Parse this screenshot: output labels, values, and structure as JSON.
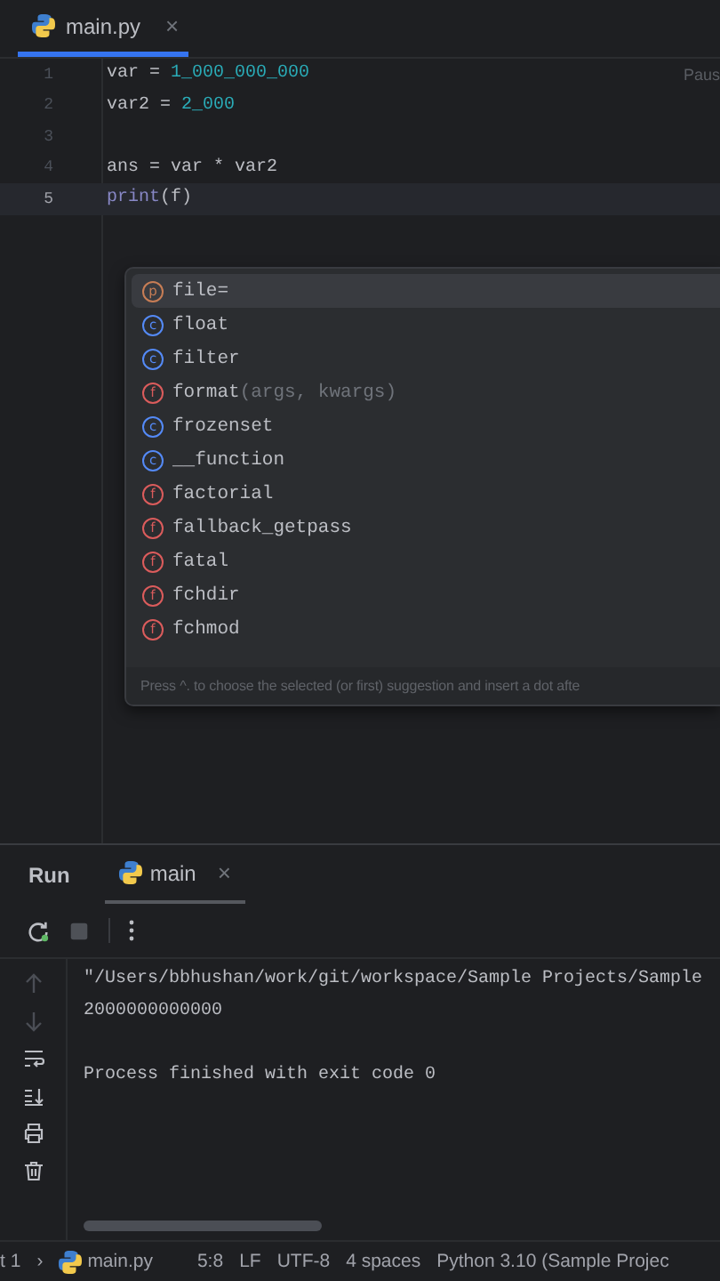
{
  "editor_tabs": [
    {
      "label": "main.py",
      "close": "×",
      "selected": true
    }
  ],
  "code_lines": [
    {
      "number": "1",
      "current": false,
      "tokens": [
        {
          "kind": "text",
          "text": "var = "
        },
        {
          "kind": "number",
          "text": "1_000_000_000"
        }
      ],
      "hint": "Paus"
    },
    {
      "number": "2",
      "current": false,
      "tokens": [
        {
          "kind": "text",
          "text": "var2 = "
        },
        {
          "kind": "number",
          "text": "2_000"
        }
      ]
    },
    {
      "number": "3",
      "current": false
    },
    {
      "number": "4",
      "current": false,
      "tokens": [
        {
          "kind": "text",
          "text": "ans = var * var2"
        }
      ]
    },
    {
      "number": "5",
      "current": true,
      "tokens": [
        {
          "kind": "builtin",
          "text": "print"
        },
        {
          "kind": "text",
          "text": "(f)"
        }
      ]
    }
  ],
  "completion": {
    "items": [
      {
        "kind": "parameter",
        "badge": "p",
        "name": "file=",
        "selected": true
      },
      {
        "kind": "class",
        "badge": "c",
        "name": "float",
        "selected": false
      },
      {
        "kind": "class",
        "badge": "c",
        "name": "filter",
        "selected": false
      },
      {
        "kind": "function",
        "badge": "f",
        "name": "format",
        "params": "(args, kwargs)",
        "selected": false
      },
      {
        "kind": "class",
        "badge": "c",
        "name": "frozenset",
        "selected": false
      },
      {
        "kind": "class",
        "badge": "c",
        "name": "__function",
        "selected": false
      },
      {
        "kind": "function",
        "badge": "f",
        "name": "factorial",
        "selected": false
      },
      {
        "kind": "function",
        "badge": "f",
        "name": "fallback_getpass",
        "selected": false
      },
      {
        "kind": "function",
        "badge": "f",
        "name": "fatal",
        "selected": false
      },
      {
        "kind": "function",
        "badge": "f",
        "name": "fchdir",
        "selected": false
      },
      {
        "kind": "function",
        "badge": "f",
        "name": "fchmod",
        "selected": false
      }
    ],
    "footer": "Press ^. to choose the selected (or first) suggestion and insert a dot afte"
  },
  "run_panel": {
    "title": "Run",
    "tabs": [
      {
        "label": "main",
        "close": "×",
        "selected": true
      }
    ],
    "output_blocks": [
      {
        "lines": [
          "\"/Users/bbhushan/work/git/workspace/Sample Projects/Sample",
          "2000000000000"
        ]
      },
      {
        "lines": [
          "Process finished with exit code 0"
        ]
      }
    ]
  },
  "status_bar": {
    "breadcrumb": [
      "t 1",
      "›"
    ],
    "file": "main.py",
    "items": [
      "5:8",
      "LF",
      "UTF-8",
      "4 spaces",
      "Python 3.10 (Sample Projec"
    ]
  }
}
